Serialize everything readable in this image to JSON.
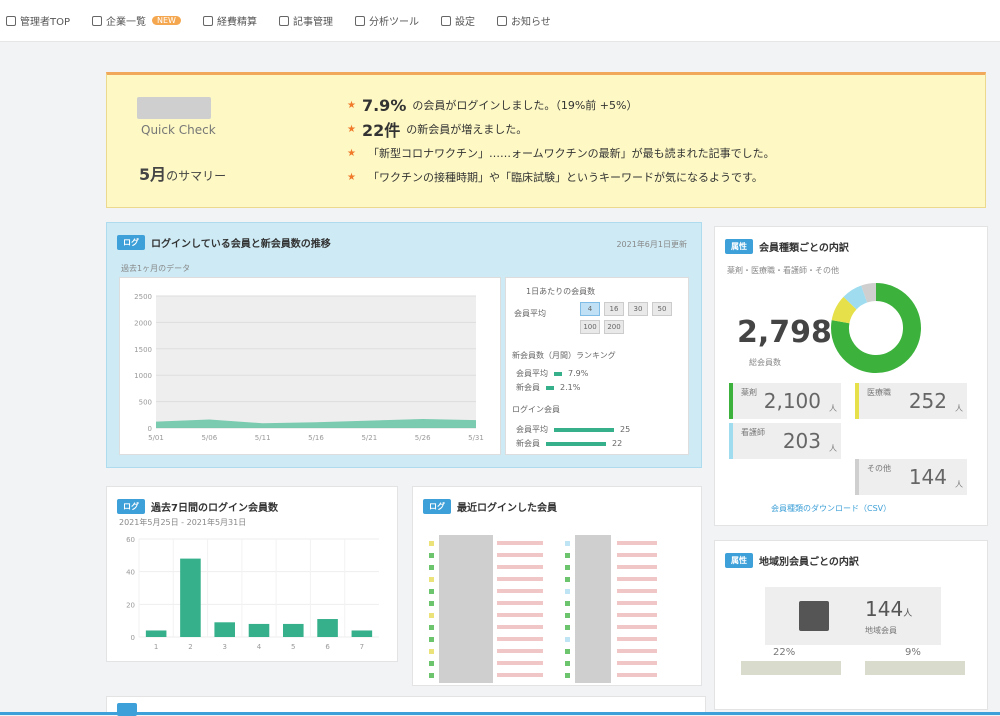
{
  "nav": [
    {
      "label": "管理者TOP",
      "icon": "user-icon"
    },
    {
      "label": "企業一覧",
      "icon": "list-icon",
      "badge": "NEW"
    },
    {
      "label": "経費精算",
      "icon": "gear-icon"
    },
    {
      "label": "記事管理",
      "icon": "pencil-icon"
    },
    {
      "label": "分析ツール",
      "icon": "chart-icon"
    },
    {
      "label": "設定",
      "icon": "cog-icon"
    },
    {
      "label": "お知らせ",
      "icon": "calendar-icon"
    }
  ],
  "quick_check": {
    "title": "Quick Check",
    "summary_num": "5月",
    "summary_label": "のサマリー",
    "items": [
      {
        "big": "7.9%",
        "text": "の会員がログインしました。（19%前 +5%）"
      },
      {
        "big": "22件",
        "text": "の新会員が増えました。"
      },
      {
        "big": "",
        "text": "「新型コロナワクチン」……ォームワクチンの最新」が最も読まれた記事でした。"
      },
      {
        "big": "",
        "text": "「ワクチンの接種時期」や「臨床試験」というキーワードが気になるようです。"
      }
    ]
  },
  "login_card": {
    "tag": "ログ",
    "title": "ログインしている会員と新会員数の推移",
    "right_note": "2021年6月1日更新",
    "sub": "過去1ヶ月のデータ",
    "side_title": "1日あたりの会員数",
    "side_row_label": "会員平均",
    "side_grid": [
      "4",
      "16",
      "30",
      "50",
      "100",
      "200"
    ],
    "side_sec2": "新会員数（月間）ランキング",
    "side_sec2_rows": [
      {
        "label": "会員平均",
        "val": "7.9%"
      },
      {
        "label": "新会員",
        "val": "2.1%"
      }
    ],
    "side_sec3": "ログイン会員",
    "side_sec3_rows": [
      {
        "label": "会員平均",
        "val": "25"
      },
      {
        "label": "新会員",
        "val": "22"
      }
    ],
    "y_ticks": [
      "2500",
      "2000",
      "1500",
      "1000",
      "500",
      "0"
    ],
    "x_ticks": [
      "5/01",
      "5/06",
      "5/11",
      "5/16",
      "5/21",
      "5/26",
      "5/31"
    ]
  },
  "chart_data": [
    {
      "type": "area",
      "x": [
        "5/01",
        "5/06",
        "5/11",
        "5/16",
        "5/21",
        "5/26",
        "5/31"
      ],
      "series": [
        {
          "values": [
            120,
            160,
            90,
            110,
            140,
            170,
            150
          ]
        }
      ],
      "ylim": [
        0,
        2500
      ]
    },
    {
      "type": "bar",
      "categories": [
        "1",
        "2",
        "3",
        "4",
        "5",
        "6",
        "7"
      ],
      "values": [
        4,
        48,
        9,
        8,
        8,
        11,
        4
      ],
      "ylim": [
        0,
        60
      ]
    },
    {
      "type": "pie",
      "labels": [
        "薬剤",
        "医療職",
        "看護師",
        "その他"
      ],
      "values": [
        2100,
        252,
        203,
        144
      ]
    }
  ],
  "period_card": {
    "tag": "ログ",
    "title": "過去7日間のログイン会員数",
    "sub": "2021年5月25日 - 2021年5月31日",
    "y_ticks": [
      "60",
      "40",
      "20",
      "0"
    ]
  },
  "ranking_card": {
    "tag": "ログ",
    "title": "最近ログインした会員"
  },
  "attr_card": {
    "tag": "属性",
    "title": "会員種類ごとの内訳",
    "legend": "薬剤・医療職・看護師・その他",
    "total": "2,798",
    "total_label": "総会員数",
    "stats": [
      {
        "label": "薬剤",
        "value": "2,100",
        "unit": "人"
      },
      {
        "label": "医療職",
        "value": "252",
        "unit": "人"
      },
      {
        "label": "看護師",
        "value": "203",
        "unit": "人"
      },
      {
        "label": "その他",
        "value": "144",
        "unit": "人"
      }
    ],
    "link": "会員種類のダウンロード（CSV）"
  },
  "attr2_card": {
    "tag": "属性",
    "title": "地域別会員ごとの内訳",
    "value": "144",
    "unit": "人",
    "label": "地域会員",
    "bottom": [
      {
        "v": "22",
        "u": "%"
      },
      {
        "v": "9",
        "u": "%"
      }
    ]
  },
  "colors": {
    "accent": "#3ea0d8",
    "green": "#35b08a",
    "donut_green": "#3cb23c",
    "yellow": "#e6e04a",
    "cyan": "#9fdcef",
    "qc_bg": "#fdf8c4"
  }
}
